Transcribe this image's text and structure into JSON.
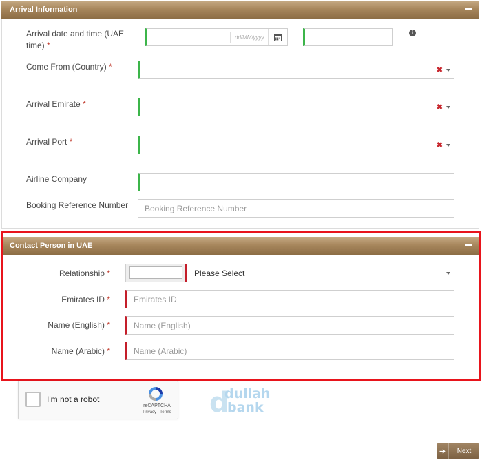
{
  "arrival": {
    "header": "Arrival Information",
    "date_label": "Arrival date and time (UAE time)",
    "date_label_line1": "Arrival date and time (UAE",
    "date_label_line2": "time)",
    "date_placeholder": "dd/MM/yyyy",
    "country_label": "Come From (Country)",
    "emirate_label": "Arrival Emirate",
    "port_label": "Arrival Port",
    "airline_label": "Airline Company",
    "booking_label": "Booking Reference Number",
    "booking_placeholder": "Booking Reference Number"
  },
  "contact": {
    "header": "Contact Person in UAE",
    "relationship_label": "Relationship",
    "relationship_value": "Please Select",
    "emirates_id_label": "Emirates ID",
    "emirates_id_placeholder": "Emirates ID",
    "name_en_label": "Name (English)",
    "name_en_placeholder": "Name (English)",
    "name_ar_label": "Name (Arabic)",
    "name_ar_placeholder": "Name (Arabic)"
  },
  "recaptcha": {
    "label": "I'm not a robot",
    "brand": "reCAPTCHA",
    "terms": "Privacy - Terms"
  },
  "watermark": {
    "line1": "dullah",
    "line2": "bank"
  },
  "nav": {
    "next": "Next"
  },
  "required_mark": "*",
  "clear_mark": "✖",
  "colors": {
    "header": "#a8875d",
    "valid": "#3cb54a",
    "required": "#c41e2a",
    "highlight": "#e8141c"
  }
}
